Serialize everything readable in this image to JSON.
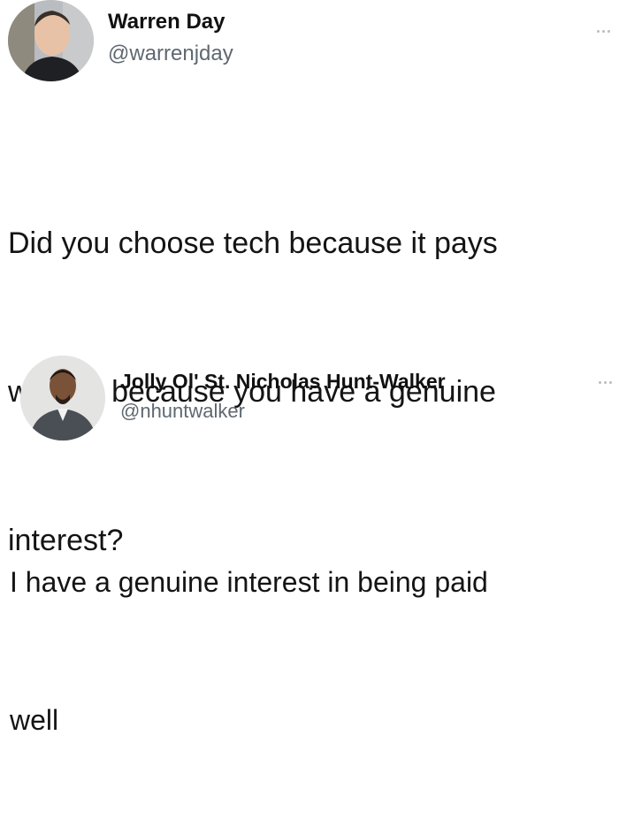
{
  "tweets": [
    {
      "author_name": "Warren Day",
      "handle": "@warrenjday",
      "avatar_icon": "profile-photo-icon",
      "more_icon": "more-options-icon",
      "text_lines": [
        "Did you choose tech because it pays",
        "well, or because you have a genuine",
        "interest?"
      ]
    },
    {
      "author_name": "Jolly Ol' St. Nicholas Hunt-Walker",
      "handle": "@nhuntwalker",
      "avatar_icon": "profile-photo-icon",
      "more_icon": "more-options-icon",
      "text_lines": [
        "I have a genuine interest in being paid",
        "well"
      ]
    }
  ],
  "colors": {
    "background": "#ffffff",
    "text": "#141414",
    "handle": "#5f6870",
    "more_dots": "#b8bec4"
  }
}
